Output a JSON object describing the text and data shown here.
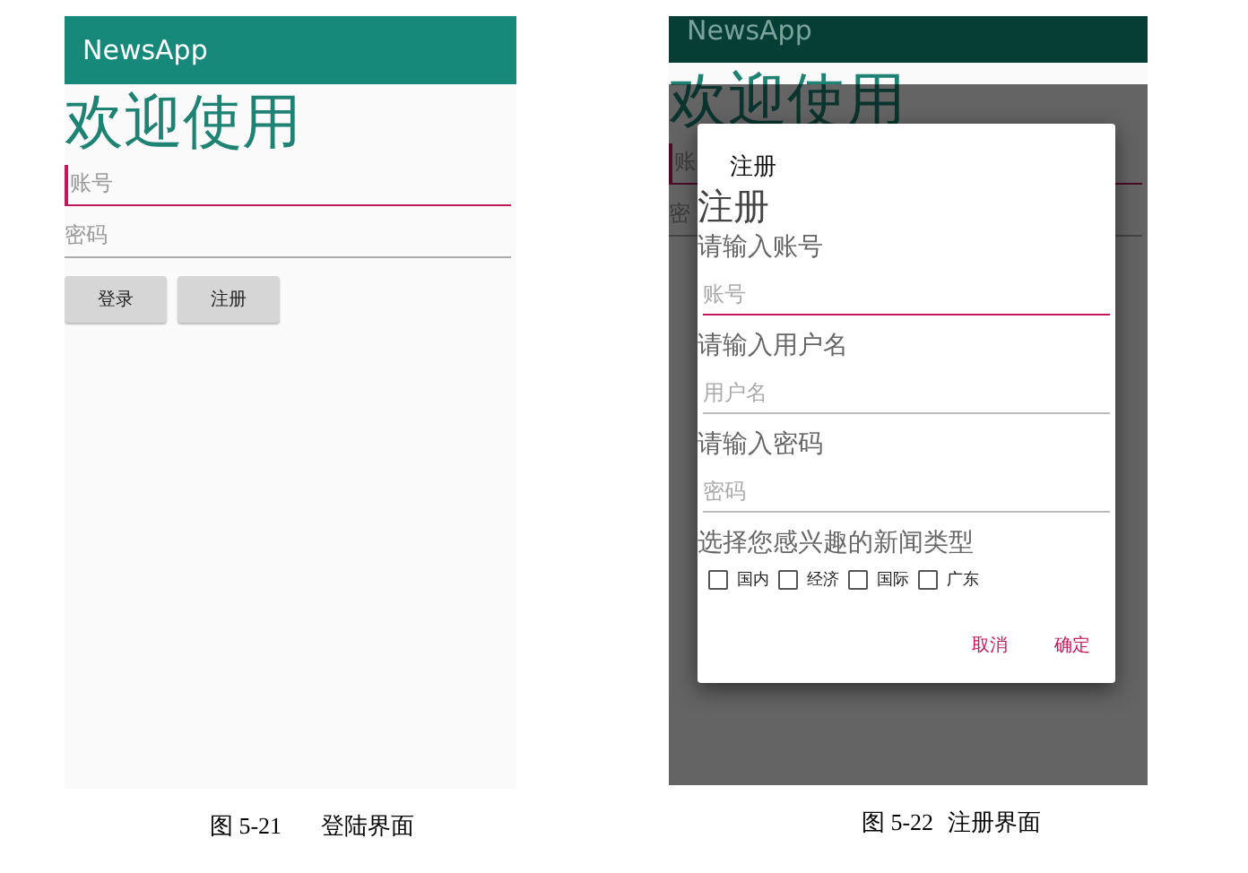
{
  "login_screen": {
    "app_bar": {
      "title": "NewsApp"
    },
    "welcome": "欢迎使用",
    "fields": [
      {
        "placeholder": "账号",
        "focused": true
      },
      {
        "placeholder": "密码",
        "focused": false
      }
    ],
    "buttons": [
      "登录",
      "注册"
    ]
  },
  "login_caption": {
    "figure": "图 5-21",
    "title": "登陆界面"
  },
  "register_screen": {
    "background": {
      "app_bar": {
        "title": "NewsApp"
      },
      "welcome": "欢迎使用",
      "fields": [
        {
          "placeholder": "账",
          "focused": true
        },
        {
          "placeholder": "密",
          "focused": false
        }
      ]
    },
    "dialog": {
      "title": "注册",
      "heading": "注册",
      "sections": [
        {
          "label": "请输入账号",
          "placeholder": "账号",
          "focused": true
        },
        {
          "label": "请输入用户名",
          "placeholder": "用户名",
          "focused": false
        },
        {
          "label": "请输入密码",
          "placeholder": "密码",
          "focused": false
        }
      ],
      "interest_label": "选择您感兴趣的新闻类型",
      "interests": [
        {
          "label": "国内",
          "checked": false
        },
        {
          "label": "经济",
          "checked": false
        },
        {
          "label": "国际",
          "checked": false
        },
        {
          "label": "广东",
          "checked": false
        }
      ],
      "buttons": [
        "取消",
        "确定"
      ]
    }
  },
  "register_caption": {
    "figure": "图 5-22",
    "title": "注册界面"
  }
}
